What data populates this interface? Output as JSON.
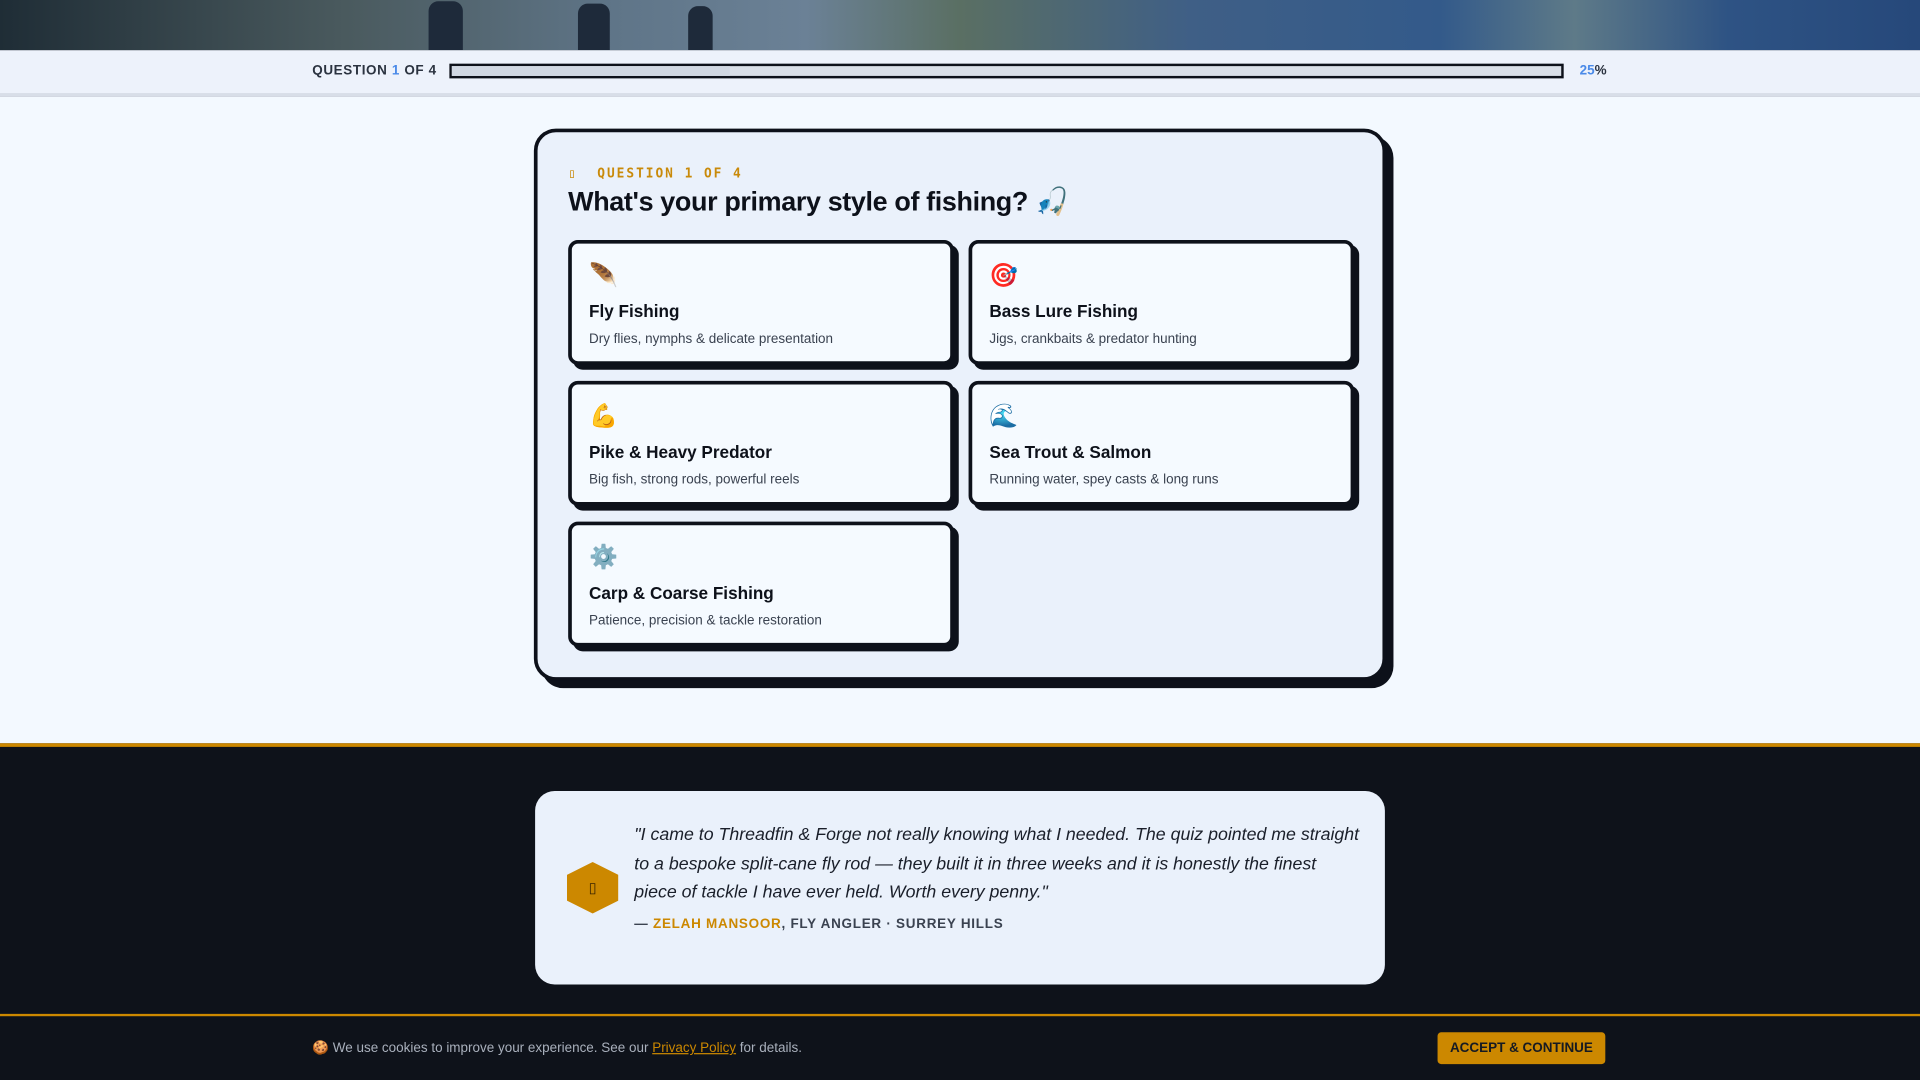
{
  "progress": {
    "prefix": "QUESTION",
    "current": "1",
    "suffix": "OF 4",
    "percent_value": "25",
    "percent_sign": "%",
    "fraction": 0.25
  },
  "quiz": {
    "eyebrow_icon": "▯",
    "eyebrow": "QUESTION 1 OF 4",
    "title": "What's your primary style of fishing? 🎣",
    "options": [
      {
        "icon": "🪶",
        "icon_name": "feather-icon",
        "name": "Fly Fishing",
        "desc": "Dry flies, nymphs & delicate presentation"
      },
      {
        "icon": "🎯",
        "icon_name": "target-icon",
        "name": "Bass Lure Fishing",
        "desc": "Jigs, crankbaits & predator hunting"
      },
      {
        "icon": "💪",
        "icon_name": "flexed-arm-icon",
        "name": "Pike & Heavy Predator",
        "desc": "Big fish, strong rods, powerful reels"
      },
      {
        "icon": "🌊",
        "icon_name": "wave-icon",
        "name": "Sea Trout & Salmon",
        "desc": "Running water, spey casts & long runs"
      },
      {
        "icon": "⚙️",
        "icon_name": "gear-icon",
        "name": "Carp & Coarse Fishing",
        "desc": "Patience, precision & tackle restoration"
      }
    ]
  },
  "testimonial": {
    "badge_glyph": "▯",
    "quote": "\"I came to Threadfin & Forge not really knowing what I needed. The quiz pointed me straight to a bespoke split-cane fly rod — they built it in three weeks and it is honestly the finest piece of tackle I have ever held. Worth every penny.\"",
    "dash": "— ",
    "name": "ZELAH MANSOOR",
    "role": ", FLY ANGLER · SURREY HILLS"
  },
  "cookie": {
    "icon": "🍪",
    "text_before": " We use cookies to improve your experience. See our ",
    "link": "Privacy Policy",
    "text_after": " for details.",
    "accept": "ACCEPT & CONTINUE"
  },
  "colors": {
    "accent": "#cc8800",
    "ink": "#0d111a",
    "blue": "#4a8ae8"
  }
}
